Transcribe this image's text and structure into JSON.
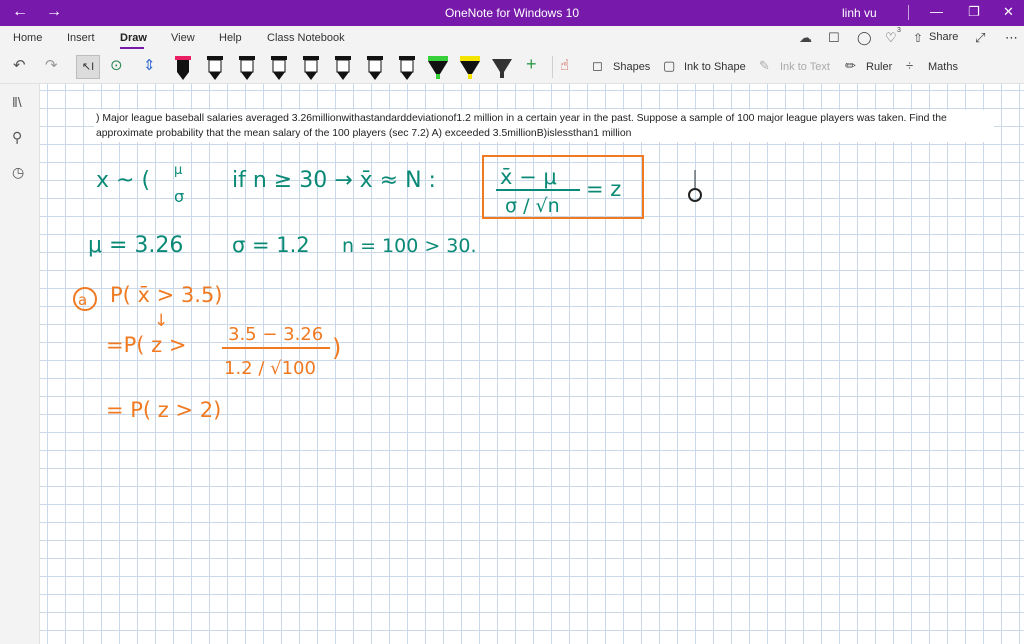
{
  "titlebar": {
    "back_icon": "back-arrow-icon",
    "forward_icon": "forward-arrow-icon",
    "title": "OneNote for Windows 10",
    "user": "linh vu",
    "bg_color": "#7719aa"
  },
  "tabs": [
    {
      "label": "Home"
    },
    {
      "label": "Insert"
    },
    {
      "label": "Draw",
      "active": true
    },
    {
      "label": "View"
    },
    {
      "label": "Help"
    },
    {
      "label": "Class Notebook"
    }
  ],
  "ribbon_right": {
    "share_label": "Share",
    "notification_count": "3"
  },
  "toolbar": {
    "shapes_label": "Shapes",
    "ink_to_shape_label": "Ink to Shape",
    "ink_to_text_label": "Ink to Text",
    "ruler_label": "Ruler",
    "maths_label": "Maths",
    "pen_colors": [
      "#e91e63",
      "#111111",
      "#111111",
      "#111111",
      "#111111",
      "#111111",
      "#111111",
      "#111111",
      "#36d13a",
      "#f4e400",
      "#333333"
    ]
  },
  "page": {
    "question": ") Major league baseball salaries averaged 3.26millionwithastandarddeviationof1.2 million in a certain year in the past. Suppose a sample of 100 major league players was taken. Find the approximate probability that the mean salary of the 100 players (sec 7.2) A) exceeded 3.5millionB)islessthan1 million",
    "ink": {
      "line1_a": "x ~ (",
      "mu": "μ",
      "sigma": "σ",
      "line1_b": "if  n ≥ 30 →  x̄ ≈ N :",
      "formula_top": "x̄ − μ",
      "formula_bottom": "σ / √n",
      "formula_eq": "= z",
      "line2_mu": "μ = 3.26",
      "line2_sigma": "σ = 1.2",
      "line2_n": "n = 100 > 30.",
      "a_label": "a",
      "step1": "P(  x̄ > 3.5)",
      "arrow": "↓",
      "step2_left": "=P( z >",
      "step2_num": "3.5  − 3.26",
      "step2_den": "1.2 / √100",
      "step2_right": ")",
      "step3": "= P( z > 2)",
      "green_color": "#0a8a76",
      "orange_color": "#f07a22"
    }
  }
}
